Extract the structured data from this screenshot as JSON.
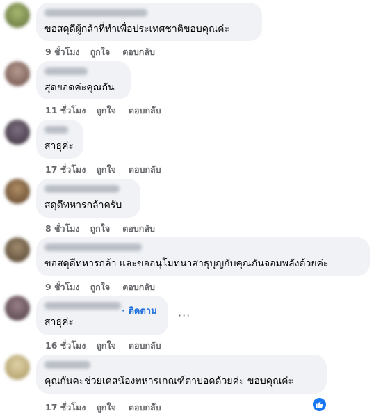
{
  "comments": [
    {
      "text": "ขอสดุดีผู้กล้าที่ทำเพื่อประเทศชาติขอบคุณค่ะ",
      "time": "9 ชั่วโมง",
      "like": "ถูกใจ",
      "reply": "ตอบกลับ",
      "avatar_color": "#8a9a5b"
    },
    {
      "text": "สุดยอดค่ะคุณกัน",
      "time": "11 ชั่วโมง",
      "like": "ถูกใจ",
      "reply": "ตอบกลับ",
      "avatar_color": "#8c6f66"
    },
    {
      "text": "สาธุค่ะ",
      "time": "17 ชั่วโมง",
      "like": "ถูกใจ",
      "reply": "ตอบกลับ",
      "avatar_color": "#5a4e5c"
    },
    {
      "text": "สดุดีทหารกล้าครับ",
      "time": "8 ชั่วโมง",
      "like": "ถูกใจ",
      "reply": "ตอบกลับ",
      "avatar_color": "#8b6a4a"
    },
    {
      "text": "ขอสดุดีทหารกล้า และขออนุโมทนาสาธุบุญกับคุณกันจอมพลังด้วยค่ะ",
      "time": "9 ชั่วโมง",
      "like": "ถูกใจ",
      "reply": "ตอบกลับ",
      "avatar_color": "#7a6a55"
    },
    {
      "text": "สาธุค่ะ",
      "time": "16 ชั่วโมง",
      "like": "ถูกใจ",
      "reply": "ตอบกลับ",
      "avatar_color": "#6e5a60",
      "follow": "· ติดตาม",
      "more": "···"
    },
    {
      "text": "คุณกันคะช่วยเคสน้องทหารเกณฑ์ตาบอดด้วยค่ะ ขอบคุณค่ะ",
      "time": "17 ชั่วโมง",
      "like": "ถูกใจ",
      "reply": "ตอบกลับ",
      "avatar_color": "#c9b98a",
      "reaction_icon": "like-reaction-icon"
    }
  ]
}
